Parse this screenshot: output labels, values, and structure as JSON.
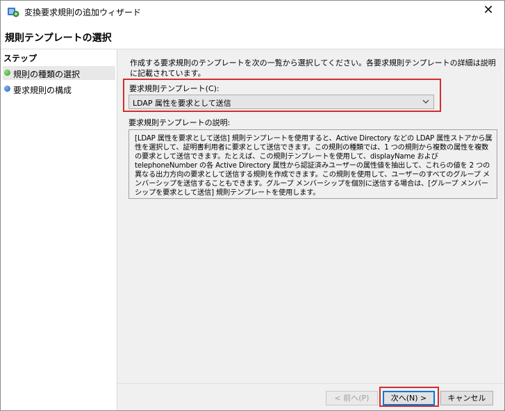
{
  "window": {
    "title": "変換要求規則の追加ウィザード",
    "close_glyph": "✕"
  },
  "header": {
    "page_title": "規則テンプレートの選択"
  },
  "sidebar": {
    "heading": "ステップ",
    "steps": [
      {
        "label": "規則の種類の選択",
        "status": "current",
        "color": "#2e9c1a"
      },
      {
        "label": "要求規則の構成",
        "status": "pending",
        "color": "#1b5fc9"
      }
    ]
  },
  "main": {
    "intro": "作成する要求規則のテンプレートを次の一覧から選択してください。各要求規則テンプレートの詳細は説明に記載されています。",
    "template_label": "要求規則テンプレート(C):",
    "template_selected": "LDAP 属性を要求として送信",
    "description_label": "要求規則テンプレートの説明:",
    "description": "[LDAP 属性を要求として送信] 規則テンプレートを使用すると、Active Directory などの LDAP 属性ストアから属性を選択して、証明書利用者に要求として送信できます。この規則の種類では、1 つの規則から複数の属性を複数の要求として送信できます。たとえば、この規則テンプレートを使用して、displayName および telephoneNumber の各 Active Directory 属性から認証済みユーザーの属性値を抽出して、これらの値を 2 つの異なる出力方向の要求として送信する規則を作成できます。この規則を使用して、ユーザーのすべてのグループ メンバーシップを送信することもできます。グループ メンバーシップを個別に送信する場合は、[グループ メンバーシップを要求として送信] 規則テンプレートを使用します。"
  },
  "footer": {
    "prev_label": "< 前へ(P)",
    "next_label": "次へ(N) >",
    "cancel_label": "キャンセル"
  },
  "colors": {
    "highlight": "#d42b2b",
    "focus": "#0078d7"
  }
}
